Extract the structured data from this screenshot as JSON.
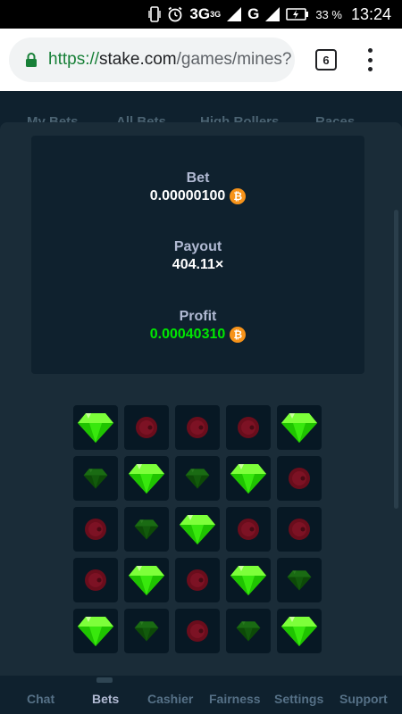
{
  "status_bar": {
    "network": "3G",
    "network_sup": "3G",
    "network2": "G",
    "battery": "33 %",
    "time": "13:24"
  },
  "browser": {
    "url_scheme": "https://",
    "url_host": "stake.com",
    "url_path": "/games/mines?",
    "tab_count": "6"
  },
  "background_tabs": [
    "My Bets",
    "All Bets",
    "High Rollers",
    "Races"
  ],
  "summary": {
    "bet_label": "Bet",
    "bet_value": "0.00000100",
    "payout_label": "Payout",
    "payout_value": "404.11×",
    "profit_label": "Profit",
    "profit_value": "0.00040310",
    "currency_icon": "bitcoin-icon",
    "currency_color": "#f7931a",
    "profit_color": "#00e701"
  },
  "grid": {
    "rows": [
      [
        "gem",
        "mine",
        "mine",
        "mine",
        "gem"
      ],
      [
        "gem-dim",
        "gem",
        "gem-dim",
        "gem",
        "mine"
      ],
      [
        "mine",
        "gem-dim",
        "gem",
        "mine",
        "mine"
      ],
      [
        "mine",
        "gem",
        "mine",
        "gem",
        "gem-dim"
      ],
      [
        "gem",
        "gem-dim",
        "mine",
        "gem-dim",
        "gem"
      ]
    ]
  },
  "bottom_nav": {
    "active": "Bets",
    "items": [
      "Chat",
      "Bets",
      "Cashier",
      "Fairness",
      "Settings",
      "Support"
    ]
  }
}
